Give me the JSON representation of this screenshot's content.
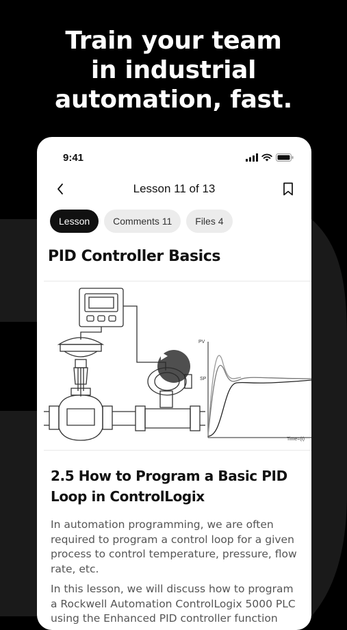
{
  "headline": {
    "line1": "Train your team",
    "line2": "in industrial",
    "line3": "automation, fast."
  },
  "status_bar": {
    "time": "9:41"
  },
  "nav": {
    "title": "Lesson 11 of 13"
  },
  "tabs": [
    {
      "label": "Lesson",
      "active": true
    },
    {
      "label": "Comments 11",
      "active": false
    },
    {
      "label": "Files 4",
      "active": false
    }
  ],
  "lesson": {
    "title": "PID Controller Basics"
  },
  "illustration": {
    "graph_pv_label": "PV",
    "graph_sp_label": "SP",
    "graph_time_label": "Time=(t)"
  },
  "section": {
    "title": "2.5 How to Program a Basic PID Loop in ControlLogix",
    "paragraph1": "In automation programming, we are often required to program a control loop for a given process to control temperature, pressure, flow rate, etc.",
    "paragraph2": "In this lesson, we will discuss how to program a Rockwell Automation ControlLogix 5000 PLC using the Enhanced PID controller function"
  },
  "colors": {
    "background": "#000000",
    "accent": "#111111",
    "tab_inactive": "#ececec"
  }
}
